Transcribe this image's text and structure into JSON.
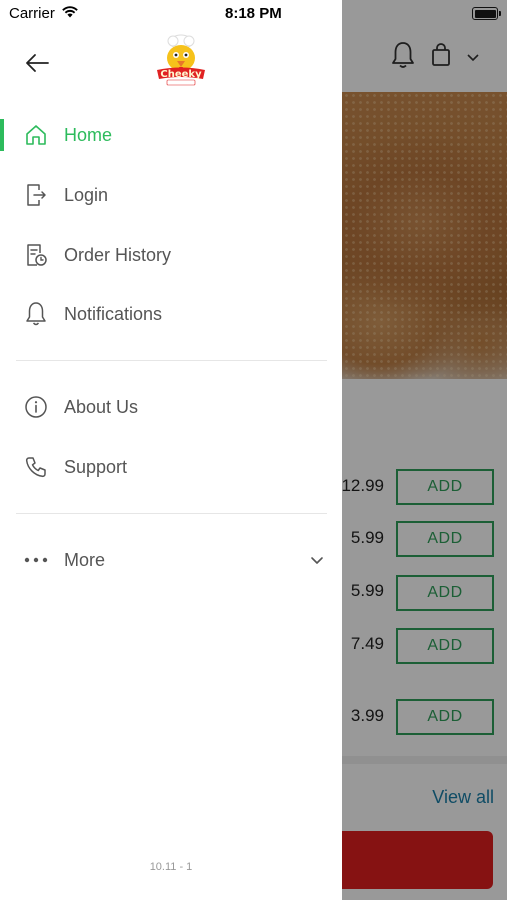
{
  "status_bar": {
    "carrier": "Carrier",
    "time": "8:18 PM"
  },
  "drawer": {
    "logo_text": "Cheeky",
    "items": [
      {
        "label": "Home",
        "icon": "home-icon",
        "active": true
      },
      {
        "label": "Login",
        "icon": "login-icon"
      },
      {
        "label": "Order History",
        "icon": "order-history-icon"
      },
      {
        "label": "Notifications",
        "icon": "bell-icon"
      },
      {
        "label": "About Us",
        "icon": "info-icon"
      },
      {
        "label": "Support",
        "icon": "phone-icon"
      },
      {
        "label": "More",
        "icon": "more-dots-icon"
      }
    ],
    "version": "10.11 - 1"
  },
  "background": {
    "menu_items": [
      {
        "price": "12.99",
        "button": "ADD"
      },
      {
        "price": "5.99",
        "button": "ADD"
      },
      {
        "price": "5.99",
        "button": "ADD"
      },
      {
        "price": "7.49",
        "button": "ADD"
      },
      {
        "price": "3.99",
        "button": "ADD"
      }
    ],
    "view_all": "View all"
  },
  "colors": {
    "accent": "#2dbb5c",
    "add_button": "#2f9f5a",
    "link": "#1a7fa8",
    "cta": "#e01f1f"
  }
}
